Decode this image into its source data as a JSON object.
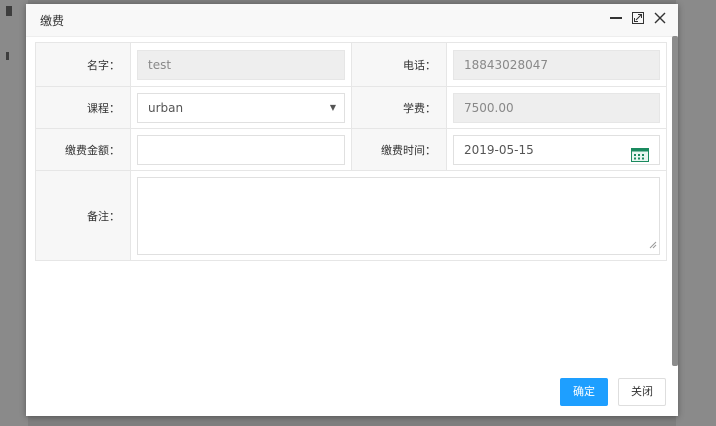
{
  "dialog": {
    "title": "缴费",
    "controls": {
      "minimize_icon": "minimize-icon",
      "maximize_icon": "maximize-icon",
      "close_icon": "close-icon"
    }
  },
  "form": {
    "name": {
      "label": "名字：",
      "value": "test"
    },
    "phone": {
      "label": "电话：",
      "value": "18843028047"
    },
    "course": {
      "label": "课程：",
      "value": "urban"
    },
    "tuition": {
      "label": "学费：",
      "value": "7500.00"
    },
    "amount": {
      "label": "缴费金额：",
      "value": ""
    },
    "pay_time": {
      "label": "缴费时间：",
      "value": "2019-05-15"
    },
    "remark": {
      "label": "备注：",
      "value": ""
    }
  },
  "footer": {
    "confirm_label": "确定",
    "close_label": "关闭"
  },
  "colors": {
    "primary": "#1e9fff",
    "readonly_bg": "#eeeeee",
    "label_bg": "#f7f7f7"
  }
}
